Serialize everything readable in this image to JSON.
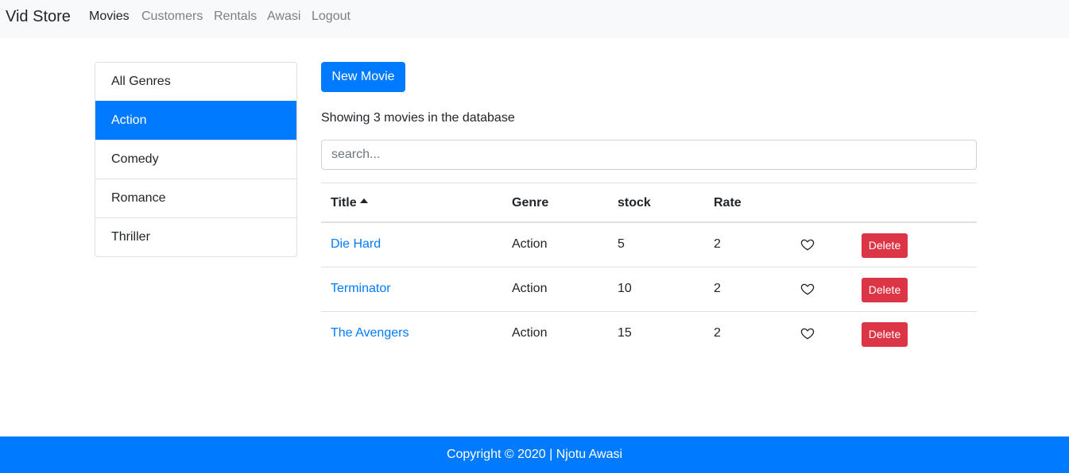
{
  "navbar": {
    "brand": "Vid Store",
    "links": [
      "Movies",
      "Customers",
      "Rentals",
      "Awasi",
      "Logout"
    ]
  },
  "sidebar": {
    "genres": [
      "All Genres",
      "Action",
      "Comedy",
      "Romance",
      "Thriller"
    ],
    "selected": "Action"
  },
  "main": {
    "new_movie_label": "New Movie",
    "summary": "Showing 3 movies in the database",
    "search_placeholder": "search...",
    "columns": [
      "Title",
      "Genre",
      "stock",
      "Rate"
    ],
    "rows": [
      {
        "title": "Die Hard",
        "genre": "Action",
        "stock": "5",
        "rate": "2",
        "delete_label": "Delete"
      },
      {
        "title": "Terminator",
        "genre": "Action",
        "stock": "10",
        "rate": "2",
        "delete_label": "Delete"
      },
      {
        "title": "The Avengers",
        "genre": "Action",
        "stock": "15",
        "rate": "2",
        "delete_label": "Delete"
      }
    ]
  },
  "footer": {
    "text": "Copyright © 2020 | Njotu Awasi"
  },
  "colors": {
    "primary": "#007bff",
    "danger": "#dc3545",
    "navbar_bg": "#f8f9fa"
  },
  "icons": {
    "sort": "caret-up-icon",
    "like": "heart-outline-icon"
  }
}
